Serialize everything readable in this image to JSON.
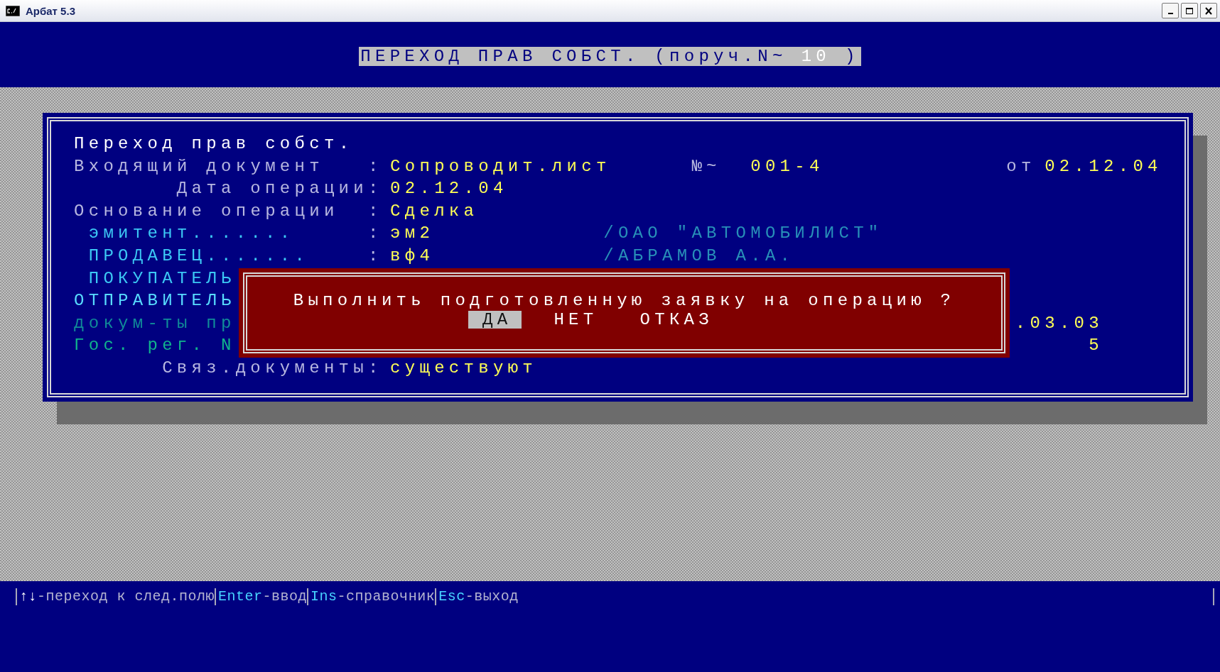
{
  "window": {
    "title": "Арбат 5.3"
  },
  "header": {
    "title": "ПЕРЕХОД ПРАВ СОБСТ. (поруч.N~",
    "number": "10",
    "closing": ")"
  },
  "form": {
    "rows": [
      {
        "kind": "heading",
        "label": "Переход прав собст."
      },
      {
        "kind": "document",
        "label": "Входящий документ",
        "separator": ":",
        "value": "Сопроводит.лист",
        "number_label": "№~",
        "number": "001-4",
        "date_label": "от",
        "date": "02.12.04"
      },
      {
        "kind": "field_right",
        "label": "Дата операции",
        "separator": ":",
        "value": "02.12.04"
      },
      {
        "kind": "field",
        "label": "Основание операции",
        "separator": ":",
        "value": "Сделка"
      },
      {
        "kind": "party",
        "label": "эмитент.......",
        "separator": ":",
        "value": "эм2",
        "name": "/ОАО \"АВТОМОБИЛИСТ\""
      },
      {
        "kind": "party",
        "label": "ПРОДАВЕЦ.......",
        "separator": ":",
        "value": "вф4",
        "name": "/АБРАМОВ А.А."
      },
      {
        "kind": "party",
        "label": "ПОКУПАТЕЛЬ"
      },
      {
        "kind": "sender",
        "label": "ОТПРАВИТЕЛЬ"
      },
      {
        "kind": "documents",
        "label": "докум-ты пр",
        "tail": ".03.03"
      },
      {
        "kind": "registration",
        "label": "Гос. рег. N",
        "tail": "5"
      },
      {
        "kind": "field_right",
        "label": "Связ.документы",
        "separator": ":",
        "value": "существуют"
      }
    ]
  },
  "dialog": {
    "message": "Выполнить подготовленную заявку на операцию ?",
    "buttons": [
      {
        "label": "ДА",
        "selected": true
      },
      {
        "label": "НЕТ",
        "selected": false
      },
      {
        "label": "ОТКАЗ",
        "selected": false
      }
    ]
  },
  "status_bar": {
    "hints": [
      {
        "kind": "arrows",
        "key": "↑↓",
        "action": "-переход к след.полю"
      },
      {
        "kind": "key",
        "key": "Enter",
        "action": "-ввод"
      },
      {
        "kind": "key",
        "key": "Ins",
        "action": "-справочник"
      },
      {
        "kind": "key",
        "key": "Esc",
        "action": "-выход"
      }
    ]
  }
}
